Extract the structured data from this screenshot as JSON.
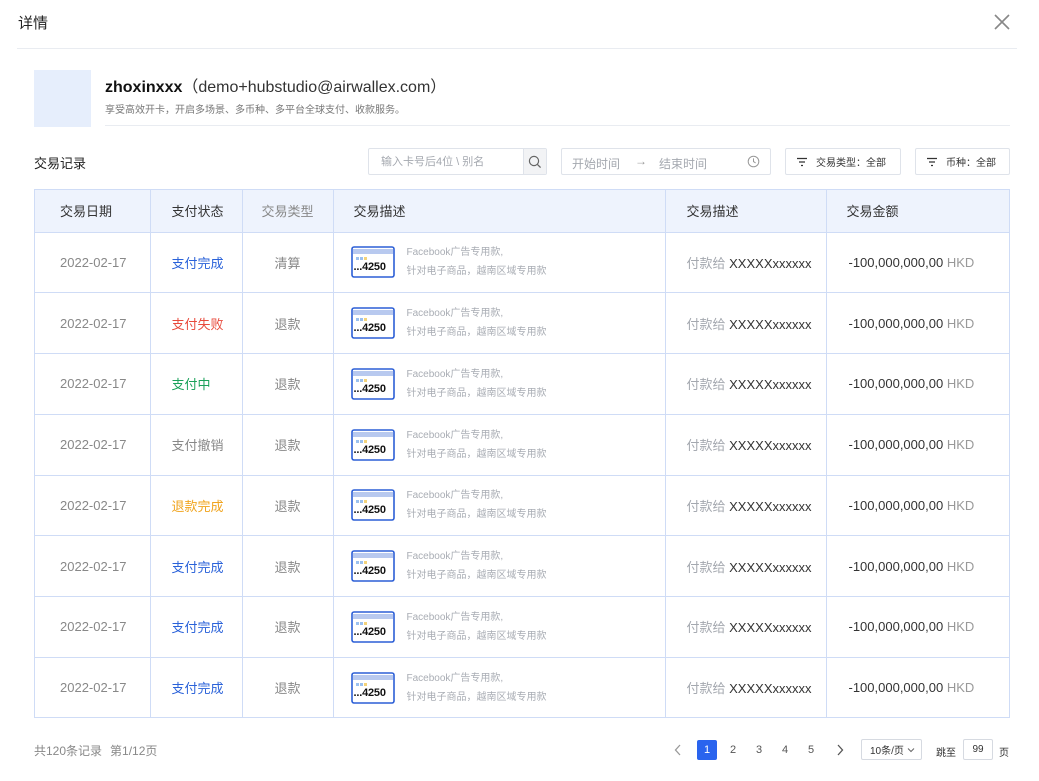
{
  "header": {
    "title": "详情"
  },
  "user": {
    "name": "zhoxinxxx",
    "email": "（demo+hubstudio@airwallex.com）",
    "description": "享受高效开卡，开启多场景、多币种、多平台全球支付、收款服务。"
  },
  "section": {
    "title": "交易记录"
  },
  "search": {
    "placeholder": "输入卡号后4位 \\ 别名"
  },
  "date_range": {
    "start_placeholder": "开始时间",
    "arrow": "→",
    "end_placeholder": "结束时间"
  },
  "filters": {
    "type_label": "交易类型：全部",
    "currency_label": "币种：全部"
  },
  "table": {
    "headers": [
      "交易日期",
      "支付状态",
      "交易类型",
      "交易描述",
      "交易描述",
      "交易金额"
    ],
    "status_colors": {
      "blue": "#2a62d9",
      "red": "#e84a3c",
      "green": "#1aa15a",
      "gray": "#888888",
      "orange": "#f0a41e"
    },
    "rows": [
      {
        "date": "2022-02-17",
        "status": "支付完成",
        "status_color": "blue",
        "type": "清算",
        "card": "...4250",
        "desc1": "Facebook广告专用款,",
        "desc2": "针对电子商品，越南区域专用款",
        "payee_prefix": "付款给",
        "payee": "XXXXXxxxxxx",
        "amount": "-100,000,000,00",
        "currency": "HKD"
      },
      {
        "date": "2022-02-17",
        "status": "支付失败",
        "status_color": "red",
        "type": "退款",
        "card": "...4250",
        "desc1": "Facebook广告专用款,",
        "desc2": "针对电子商品，越南区域专用款",
        "payee_prefix": "付款给",
        "payee": "XXXXXxxxxxx",
        "amount": "-100,000,000,00",
        "currency": "HKD"
      },
      {
        "date": "2022-02-17",
        "status": "支付中",
        "status_color": "green",
        "type": "退款",
        "card": "...4250",
        "desc1": "Facebook广告专用款,",
        "desc2": "针对电子商品，越南区域专用款",
        "payee_prefix": "付款给",
        "payee": "XXXXXxxxxxx",
        "amount": "-100,000,000,00",
        "currency": "HKD"
      },
      {
        "date": "2022-02-17",
        "status": "支付撤销",
        "status_color": "gray",
        "type": "退款",
        "card": "...4250",
        "desc1": "Facebook广告专用款,",
        "desc2": "针对电子商品，越南区域专用款",
        "payee_prefix": "付款给",
        "payee": "XXXXXxxxxxx",
        "amount": "-100,000,000,00",
        "currency": "HKD"
      },
      {
        "date": "2022-02-17",
        "status": "退款完成",
        "status_color": "orange",
        "type": "退款",
        "card": "...4250",
        "desc1": "Facebook广告专用款,",
        "desc2": "针对电子商品，越南区域专用款",
        "payee_prefix": "付款给",
        "payee": "XXXXXxxxxxx",
        "amount": "-100,000,000,00",
        "currency": "HKD"
      },
      {
        "date": "2022-02-17",
        "status": "支付完成",
        "status_color": "blue",
        "type": "退款",
        "card": "...4250",
        "desc1": "Facebook广告专用款,",
        "desc2": "针对电子商品，越南区域专用款",
        "payee_prefix": "付款给",
        "payee": "XXXXXxxxxxx",
        "amount": "-100,000,000,00",
        "currency": "HKD"
      },
      {
        "date": "2022-02-17",
        "status": "支付完成",
        "status_color": "blue",
        "type": "退款",
        "card": "...4250",
        "desc1": "Facebook广告专用款,",
        "desc2": "针对电子商品，越南区域专用款",
        "payee_prefix": "付款给",
        "payee": "XXXXXxxxxxx",
        "amount": "-100,000,000,00",
        "currency": "HKD"
      },
      {
        "date": "2022-02-17",
        "status": "支付完成",
        "status_color": "blue",
        "type": "退款",
        "card": "...4250",
        "desc1": "Facebook广告专用款,",
        "desc2": "针对电子商品，越南区域专用款",
        "payee_prefix": "付款给",
        "payee": "XXXXXxxxxxx",
        "amount": "-100,000,000,00",
        "currency": "HKD"
      }
    ]
  },
  "pagination": {
    "total": "共120条记录",
    "page_info": "第1/12页",
    "pages": [
      "1",
      "2",
      "3",
      "4",
      "5"
    ],
    "active_page": "1",
    "page_size": "10条/页",
    "jump_label": "跳至",
    "jump_value": "99",
    "jump_suffix": "页"
  },
  "colors": {
    "accent": "#2a64ee",
    "header_bg": "#eef3fd",
    "border": "#cfdcf6"
  },
  "icons": [
    "close-icon",
    "search-icon",
    "clock-icon",
    "filter-icon",
    "card-icon",
    "chevron-left-icon",
    "chevron-right-icon",
    "chevron-down-icon"
  ]
}
